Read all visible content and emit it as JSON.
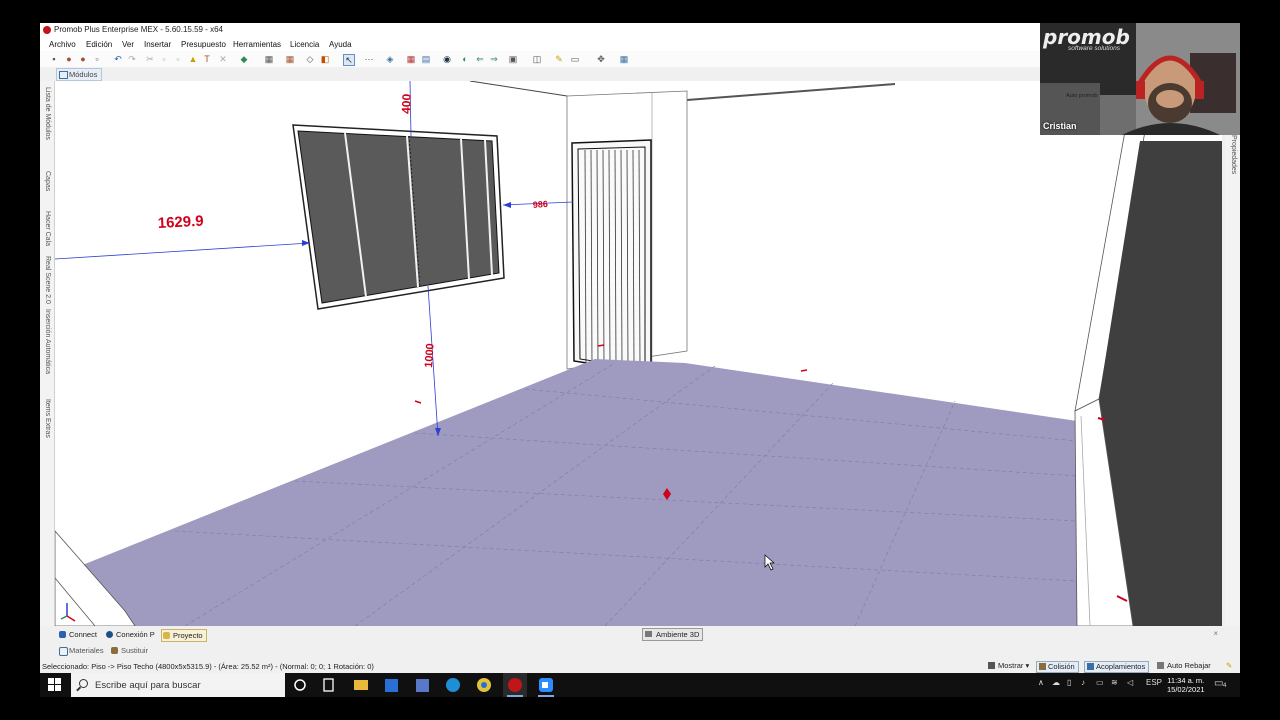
{
  "window": {
    "title": "Promob Plus Enterprise MEX - 5.60.15.59 - x64"
  },
  "menu": [
    "Archivo",
    "Edición",
    "Ver",
    "Insertar",
    "Presupuesto",
    "Herramientas",
    "Licencia",
    "Ayuda"
  ],
  "toolbar": {
    "icons": [
      "save-icon",
      "open-icon",
      "print-icon",
      "print-preview-icon",
      "undo-icon",
      "redo-icon",
      "cut-icon",
      "copy-icon",
      "paste-icon",
      "paint-icon",
      "hammer-icon",
      "delete-icon",
      "module-icon",
      "layout-icon",
      "furniture-icon",
      "shape-icon",
      "select-arrow-icon",
      "measure-icon",
      "shield-icon",
      "render-icon",
      "align-icon",
      "view-icon",
      "camera-icon",
      "walk-icon",
      "next-icon",
      "window-icon",
      "box-icon",
      "wand-icon",
      "view-options-icon",
      "move-icon",
      "grid-icon"
    ]
  },
  "tabs": {
    "modules": "Módulos"
  },
  "left_panel_tabs": [
    "Lista de Módulos",
    "Capas",
    "Hacer Cala",
    "Real Scene 2.0",
    "Inserción Automática",
    "Items Extras"
  ],
  "right_panel_tabs": [
    "Propiedades"
  ],
  "viewport": {
    "dimensions": {
      "window_left": "1629.9",
      "window_top": "400",
      "window_bottom": "1000",
      "window_right": "986"
    },
    "colors": {
      "floor": "#9e9ac0",
      "dimension_text": "#d0021b",
      "dimension_line": "#2b3fd1",
      "window_glass": "#5a5a5a",
      "dark_wall": "#3f3f3f"
    }
  },
  "bottom_tabs": {
    "left": [
      "Connect",
      "Conexión P",
      "Proyecto"
    ],
    "center": "Ambiente 3D",
    "close": "×"
  },
  "materials_tabs": [
    "Materiales",
    "Sustituir"
  ],
  "status": {
    "selection": "Seleccionado: Piso -> Piso Techo (4800x5x5315.9) - (Área: 25.52 m²) - (Normal: 0; 0; 1 Rotación: 0)",
    "buttons": [
      "Mostrar",
      "Colisión",
      "Acoplamientos",
      "Auto Rebajar"
    ]
  },
  "taskbar": {
    "search_placeholder": "Escribe aquí para buscar",
    "language": "ESP",
    "time": "11:34 a. m.",
    "date": "15/02/2021",
    "notifications": "4"
  },
  "webcam": {
    "brand": "promob",
    "subtitle": "software solutions",
    "name": "Cristian",
    "small_label": "Auto promob"
  }
}
